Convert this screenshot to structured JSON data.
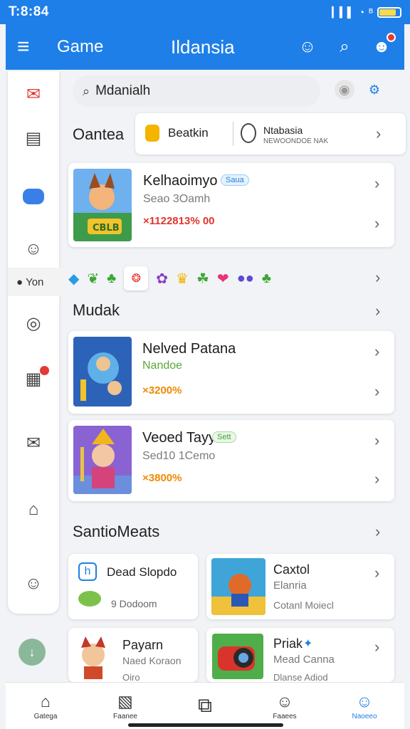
{
  "status": {
    "time": "T:8:84",
    "signal": "▎▍▌",
    "wifi": "◔",
    "bt": "ᴮ",
    "battery_level": 0.85
  },
  "appbar": {
    "title": "Game",
    "center_title": "Ildansia",
    "menu_icon": "≡",
    "profile_icon": "☺",
    "search_icon": "⌕",
    "notify_icon": "☻"
  },
  "sidebar": {
    "items": [
      {
        "icon": "chat-bubble-icon",
        "glyph": "✉"
      },
      {
        "icon": "calendar-icon",
        "glyph": "▤"
      },
      {
        "icon": "toggle-pill-icon",
        "glyph": ""
      },
      {
        "icon": "user-icon",
        "glyph": "☺"
      },
      {
        "icon": "person-dot-icon",
        "glyph": "●",
        "label": "Yon"
      },
      {
        "icon": "compass-icon",
        "glyph": "◎"
      },
      {
        "icon": "calendar-badge-icon",
        "glyph": "▦"
      },
      {
        "icon": "mail-icon",
        "glyph": "✉"
      },
      {
        "icon": "home-icon",
        "glyph": "⌂"
      },
      {
        "icon": "account-icon",
        "glyph": "☺"
      }
    ],
    "fab_glyph": "↓"
  },
  "search": {
    "glyph": "⌕",
    "value": "Mdanialh",
    "mic_glyph": "◉",
    "settings_glyph": "⚙"
  },
  "section1": {
    "title": "Oantea",
    "filter": {
      "left_label": "Beatkin",
      "right_title": "Ntabasia",
      "right_sub": "NEWOONDOE NAK"
    },
    "game": {
      "title": "Kelhaoimyo",
      "badge": "Saua",
      "subtitle": "Seao 3Oamh",
      "price": "×1122813% 00"
    }
  },
  "icon_row": [
    "◆",
    "❦",
    "♣",
    "❂",
    "✿",
    "♛",
    "☘",
    "❤",
    "●●",
    "♣"
  ],
  "section2": {
    "title": "Mudak",
    "games": [
      {
        "title": "Nelved Patana",
        "subtitle": "Nandoe",
        "price": "×3200%",
        "subtitle_color": "#5aa83a"
      },
      {
        "title": "Veoed Tayy",
        "badge": "Sett",
        "subtitle": "Sed10 1Cemo",
        "price": "×3800%",
        "subtitle_color": "#7a7a7a"
      }
    ]
  },
  "section3": {
    "title": "SantioMeats",
    "tiles": [
      {
        "title": "Dead Slopdo",
        "sub": "9 Dodoom"
      },
      {
        "title": "Caxtol",
        "sub": "Elanria",
        "sub2": "Cotanl Moiecl"
      },
      {
        "title": "Payarn",
        "sub": "Naed Koraon",
        "sub2": "Oiro"
      },
      {
        "title": "Priak",
        "sub": "Mead Canna",
        "sub2": "Dlanse Adiod"
      }
    ]
  },
  "bottomnav": [
    {
      "label": "Gatega",
      "icon": "home-icon",
      "glyph": "⌂"
    },
    {
      "label": "Faanee",
      "icon": "map-icon",
      "glyph": "▧"
    },
    {
      "label": "",
      "icon": "camera-icon",
      "glyph": "⧉"
    },
    {
      "label": "Faaees",
      "icon": "person-icon",
      "glyph": "☺"
    },
    {
      "label": "Naoeeo",
      "icon": "profile-icon",
      "glyph": "☺"
    }
  ],
  "colors": {
    "primary": "#1e7fe8",
    "price_red": "#e0352b",
    "price_orange": "#ef8a00",
    "green": "#5aa83a"
  }
}
